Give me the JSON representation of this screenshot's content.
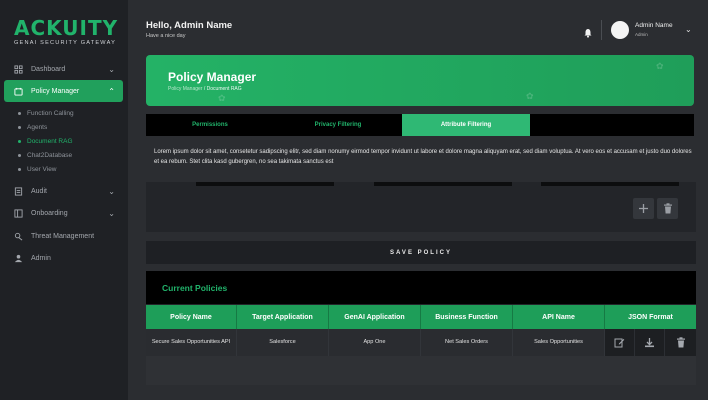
{
  "brand": {
    "name": "ACKUITY",
    "tagline": "GENAI SECURITY GATEWAY",
    "accent": "#21b36b"
  },
  "sidebar": {
    "items": [
      {
        "label": "Dashboard",
        "icon": "dashboard-icon",
        "active": false,
        "has_chevron": true
      },
      {
        "label": "Policy Manager",
        "icon": "policy-icon",
        "active": true,
        "has_chevron": true
      },
      {
        "label": "Audit",
        "icon": "audit-icon",
        "active": false,
        "has_chevron": true
      },
      {
        "label": "Onboarding",
        "icon": "onboarding-icon",
        "active": false,
        "has_chevron": true
      },
      {
        "label": "Threat Management",
        "icon": "threat-icon",
        "active": false,
        "has_chevron": false
      },
      {
        "label": "Admin",
        "icon": "admin-icon",
        "active": false,
        "has_chevron": false
      }
    ],
    "sub_items": [
      {
        "label": "Function Calling",
        "active": false
      },
      {
        "label": "Agents",
        "active": false
      },
      {
        "label": "Document RAG",
        "active": true
      },
      {
        "label": "Chat2Database",
        "active": false
      },
      {
        "label": "User View",
        "active": false
      }
    ]
  },
  "header": {
    "greeting": "Hello, Admin Name",
    "subgreeting": "Have a nice day",
    "user_name": "Admin Name",
    "user_role": "Admin"
  },
  "banner": {
    "title": "Policy Manager",
    "breadcrumb_parent": "Policy Manager",
    "breadcrumb_sep": " / ",
    "breadcrumb_current": "Document RAG"
  },
  "tabs": [
    {
      "label": "Permissions",
      "active": false
    },
    {
      "label": "Privacy Filtering",
      "active": false
    },
    {
      "label": "Attribute Filtering",
      "active": true
    }
  ],
  "description": "Lorem ipsum dolor sit amet, consetetur sadipscing elitr, sed diam nonumy eirmod tempor invidunt ut labore et dolore magna aliquyam erat, sed diam voluptua. At vero eos et accusam et justo duo dolores et ea rebum. Stet clita kasd gubergren, no sea takimata sanctus est",
  "save_label": "SAVE POLICY",
  "policies": {
    "title": "Current Policies",
    "columns": [
      "Policy Name",
      "Target Application",
      "GenAI Application",
      "Business Function",
      "API Name",
      "JSON Format"
    ],
    "rows": [
      {
        "policy_name": "Secure Sales Opportunities API",
        "target_application": "Salesforce",
        "genai_application": "App One",
        "business_function": "Net Sales Orders",
        "api_name": "Sales Opportunities"
      }
    ]
  }
}
